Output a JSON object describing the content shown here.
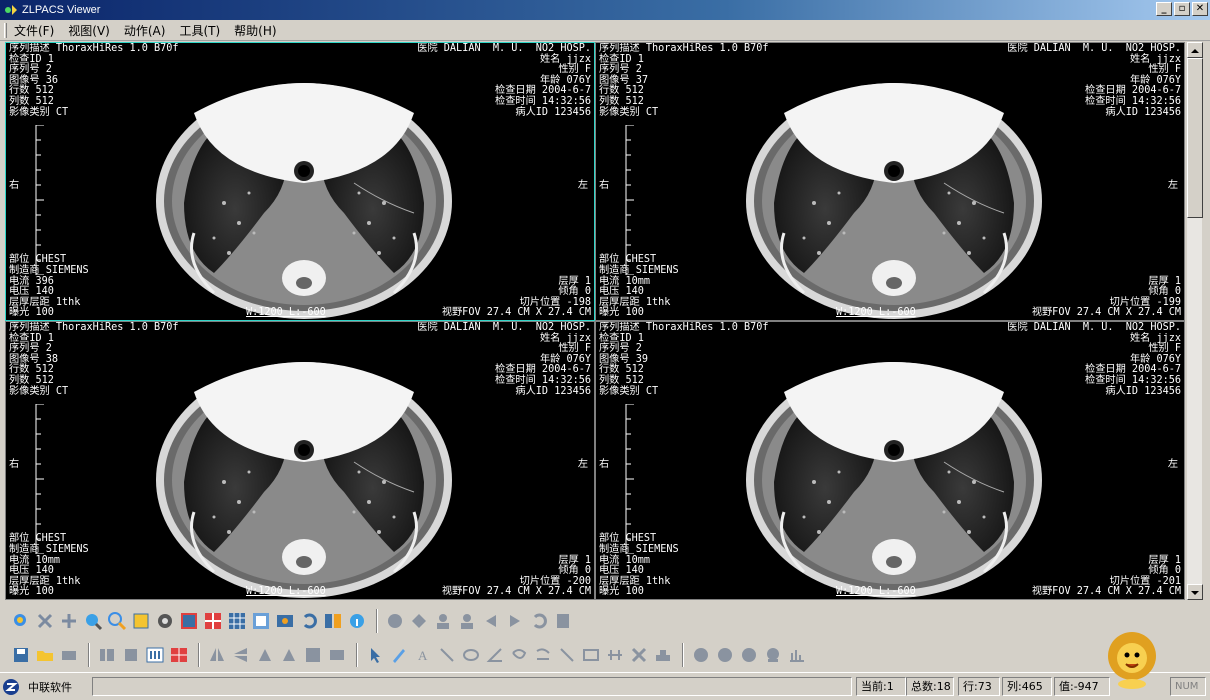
{
  "window": {
    "title": "ZLPACS Viewer",
    "min": "_",
    "max": "▫",
    "close": "✕"
  },
  "menu": [
    {
      "label": "文件(F)"
    },
    {
      "label": "视图(V)"
    },
    {
      "label": "动作(A)"
    },
    {
      "label": "工具(T)"
    },
    {
      "label": "帮助(H)"
    }
  ],
  "viewports": [
    {
      "tl": "序列描述 ThoraxHiRes 1.0 B70f\n检查ID 1\n序列号 2\n图像号 36\n行数 512\n列数 512\n影像类别 CT",
      "tr": "医院 DALIAN  M. U.  NO2 HOSP.\n姓名 jjzx\n性别 F\n年龄 076Y\n检查日期 2004-6-7\n检查时间 14:32:56\n病人ID 123456",
      "bl": "部位 CHEST\n制造商 SIEMENS\n电流 396\n电压 140\n层厚层距 1thk\n曝光 100",
      "br": "层厚 1\n倾角 0\n切片位置 -198\n视野FOV 27.4 CM X 27.4 CM",
      "wl": "W:1200 L:-600",
      "left": "右",
      "right": "左"
    },
    {
      "tl": "序列描述 ThoraxHiRes 1.0 B70f\n检查ID 1\n序列号 2\n图像号 37\n行数 512\n列数 512\n影像类别 CT",
      "tr": "医院 DALIAN  M. U.  NO2 HOSP.\n姓名 jjzx\n性别 F\n年龄 076Y\n检查日期 2004-6-7\n检查时间 14:32:56\n病人ID 123456",
      "bl": "部位 CHEST\n制造商 SIEMENS\n电流 10mm\n电压 140\n层厚层距 1thk\n曝光 100",
      "br": "层厚 1\n倾角 0\n切片位置 -199\n视野FOV 27.4 CM X 27.4 CM",
      "wl": "W:1200 L:-600",
      "left": "右",
      "right": "左"
    },
    {
      "tl": "序列描述 ThoraxHiRes 1.0 B70f\n检查ID 1\n序列号 2\n图像号 38\n行数 512\n列数 512\n影像类别 CT",
      "tr": "医院 DALIAN  M. U.  NO2 HOSP.\n姓名 jjzx\n性别 F\n年龄 076Y\n检查日期 2004-6-7\n检查时间 14:32:56\n病人ID 123456",
      "bl": "部位 CHEST\n制造商 SIEMENS\n电流 10mm\n电压 140\n层厚层距 1thk\n曝光 100",
      "br": "层厚 1\n倾角 0\n切片位置 -200\n视野FOV 27.4 CM X 27.4 CM",
      "wl": "W:1200 L:-600",
      "left": "右",
      "right": "左"
    },
    {
      "tl": "序列描述 ThoraxHiRes 1.0 B70f\n检查ID 1\n序列号 2\n图像号 39\n行数 512\n列数 512\n影像类别 CT",
      "tr": "医院 DALIAN  M. U.  NO2 HOSP.\n姓名 jjzx\n性别 F\n年龄 076Y\n检查日期 2004-6-7\n检查时间 14:32:56\n病人ID 123456",
      "bl": "部位 CHEST\n制造商 SIEMENS\n电流 10mm\n电压 140\n层厚层距 1thk\n曝光 100",
      "br": "层厚 1\n倾角 0\n切片位置 -201\n视野FOV 27.4 CM X 27.4 CM",
      "wl": "W:1200 L:-600",
      "left": "右",
      "right": "左"
    }
  ],
  "statusbar": {
    "app_name": "中联软件",
    "current": "当前:1",
    "total": "总数:18",
    "row": "行:73",
    "col": "列:465",
    "value": "值:-947",
    "num": "NUM"
  }
}
